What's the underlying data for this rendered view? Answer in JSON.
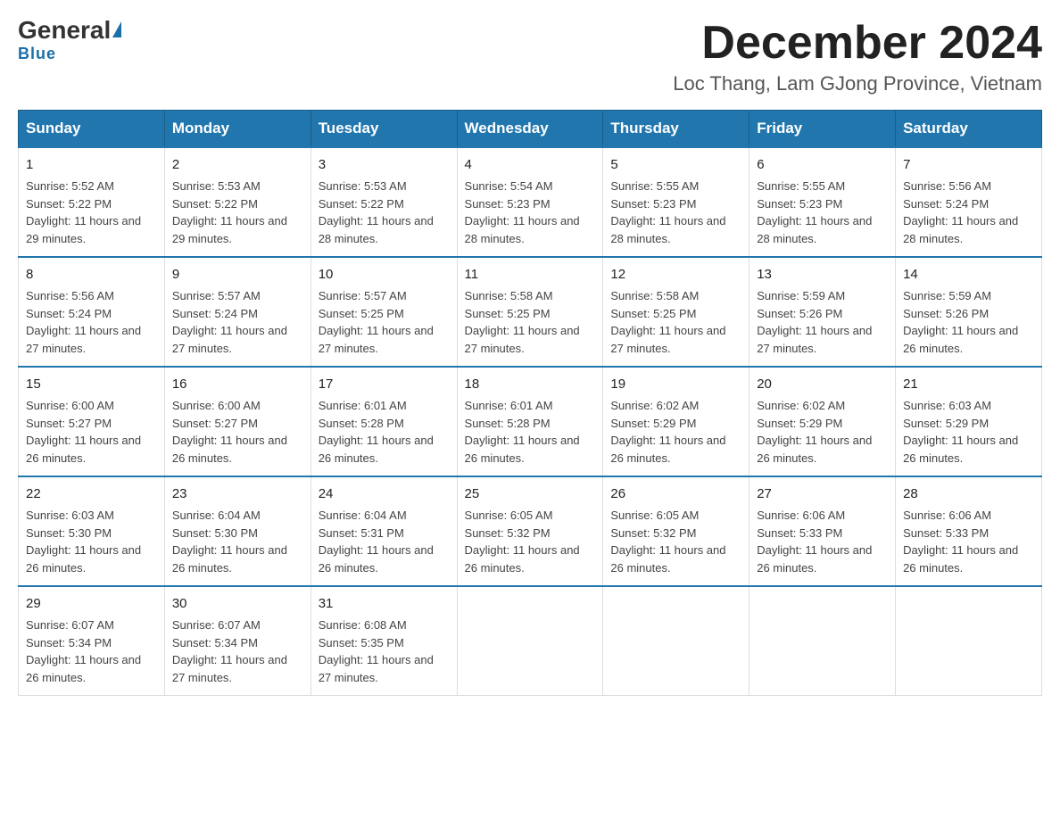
{
  "header": {
    "logo_general": "General",
    "logo_blue": "Blue",
    "month_title": "December 2024",
    "location": "Loc Thang, Lam GJong Province, Vietnam"
  },
  "days_of_week": [
    "Sunday",
    "Monday",
    "Tuesday",
    "Wednesday",
    "Thursday",
    "Friday",
    "Saturday"
  ],
  "weeks": [
    [
      {
        "day": "1",
        "sunrise": "5:52 AM",
        "sunset": "5:22 PM",
        "daylight": "11 hours and 29 minutes."
      },
      {
        "day": "2",
        "sunrise": "5:53 AM",
        "sunset": "5:22 PM",
        "daylight": "11 hours and 29 minutes."
      },
      {
        "day": "3",
        "sunrise": "5:53 AM",
        "sunset": "5:22 PM",
        "daylight": "11 hours and 28 minutes."
      },
      {
        "day": "4",
        "sunrise": "5:54 AM",
        "sunset": "5:23 PM",
        "daylight": "11 hours and 28 minutes."
      },
      {
        "day": "5",
        "sunrise": "5:55 AM",
        "sunset": "5:23 PM",
        "daylight": "11 hours and 28 minutes."
      },
      {
        "day": "6",
        "sunrise": "5:55 AM",
        "sunset": "5:23 PM",
        "daylight": "11 hours and 28 minutes."
      },
      {
        "day": "7",
        "sunrise": "5:56 AM",
        "sunset": "5:24 PM",
        "daylight": "11 hours and 28 minutes."
      }
    ],
    [
      {
        "day": "8",
        "sunrise": "5:56 AM",
        "sunset": "5:24 PM",
        "daylight": "11 hours and 27 minutes."
      },
      {
        "day": "9",
        "sunrise": "5:57 AM",
        "sunset": "5:24 PM",
        "daylight": "11 hours and 27 minutes."
      },
      {
        "day": "10",
        "sunrise": "5:57 AM",
        "sunset": "5:25 PM",
        "daylight": "11 hours and 27 minutes."
      },
      {
        "day": "11",
        "sunrise": "5:58 AM",
        "sunset": "5:25 PM",
        "daylight": "11 hours and 27 minutes."
      },
      {
        "day": "12",
        "sunrise": "5:58 AM",
        "sunset": "5:25 PM",
        "daylight": "11 hours and 27 minutes."
      },
      {
        "day": "13",
        "sunrise": "5:59 AM",
        "sunset": "5:26 PM",
        "daylight": "11 hours and 27 minutes."
      },
      {
        "day": "14",
        "sunrise": "5:59 AM",
        "sunset": "5:26 PM",
        "daylight": "11 hours and 26 minutes."
      }
    ],
    [
      {
        "day": "15",
        "sunrise": "6:00 AM",
        "sunset": "5:27 PM",
        "daylight": "11 hours and 26 minutes."
      },
      {
        "day": "16",
        "sunrise": "6:00 AM",
        "sunset": "5:27 PM",
        "daylight": "11 hours and 26 minutes."
      },
      {
        "day": "17",
        "sunrise": "6:01 AM",
        "sunset": "5:28 PM",
        "daylight": "11 hours and 26 minutes."
      },
      {
        "day": "18",
        "sunrise": "6:01 AM",
        "sunset": "5:28 PM",
        "daylight": "11 hours and 26 minutes."
      },
      {
        "day": "19",
        "sunrise": "6:02 AM",
        "sunset": "5:29 PM",
        "daylight": "11 hours and 26 minutes."
      },
      {
        "day": "20",
        "sunrise": "6:02 AM",
        "sunset": "5:29 PM",
        "daylight": "11 hours and 26 minutes."
      },
      {
        "day": "21",
        "sunrise": "6:03 AM",
        "sunset": "5:29 PM",
        "daylight": "11 hours and 26 minutes."
      }
    ],
    [
      {
        "day": "22",
        "sunrise": "6:03 AM",
        "sunset": "5:30 PM",
        "daylight": "11 hours and 26 minutes."
      },
      {
        "day": "23",
        "sunrise": "6:04 AM",
        "sunset": "5:30 PM",
        "daylight": "11 hours and 26 minutes."
      },
      {
        "day": "24",
        "sunrise": "6:04 AM",
        "sunset": "5:31 PM",
        "daylight": "11 hours and 26 minutes."
      },
      {
        "day": "25",
        "sunrise": "6:05 AM",
        "sunset": "5:32 PM",
        "daylight": "11 hours and 26 minutes."
      },
      {
        "day": "26",
        "sunrise": "6:05 AM",
        "sunset": "5:32 PM",
        "daylight": "11 hours and 26 minutes."
      },
      {
        "day": "27",
        "sunrise": "6:06 AM",
        "sunset": "5:33 PM",
        "daylight": "11 hours and 26 minutes."
      },
      {
        "day": "28",
        "sunrise": "6:06 AM",
        "sunset": "5:33 PM",
        "daylight": "11 hours and 26 minutes."
      }
    ],
    [
      {
        "day": "29",
        "sunrise": "6:07 AM",
        "sunset": "5:34 PM",
        "daylight": "11 hours and 26 minutes."
      },
      {
        "day": "30",
        "sunrise": "6:07 AM",
        "sunset": "5:34 PM",
        "daylight": "11 hours and 27 minutes."
      },
      {
        "day": "31",
        "sunrise": "6:08 AM",
        "sunset": "5:35 PM",
        "daylight": "11 hours and 27 minutes."
      },
      null,
      null,
      null,
      null
    ]
  ]
}
